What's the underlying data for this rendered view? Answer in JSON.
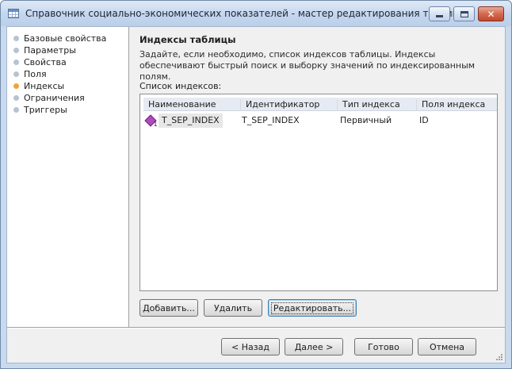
{
  "window": {
    "title": "Справочник социально-экономических показателей - мастер редактирования таблицы",
    "controls": {
      "minimize": "minimize",
      "maximize": "maximize",
      "close": "✕"
    }
  },
  "steps": [
    {
      "label": "Базовые свойства",
      "active": false
    },
    {
      "label": "Параметры",
      "active": false
    },
    {
      "label": "Свойства",
      "active": false
    },
    {
      "label": "Поля",
      "active": false
    },
    {
      "label": "Индексы",
      "active": true
    },
    {
      "label": "Ограничения",
      "active": false
    },
    {
      "label": "Триггеры",
      "active": false
    }
  ],
  "page": {
    "heading": "Индексы таблицы",
    "description": "Задайте, если необходимо, список индексов таблицы. Индексы обеспечивают быстрый поиск и выборку значений по индексированным полям.",
    "list_label": "Список индексов:"
  },
  "table": {
    "columns": [
      "Наименование",
      "Идентификатор",
      "Тип индекса",
      "Поля индекса"
    ],
    "rows": [
      {
        "name": "T_SEP_INDEX",
        "id": "T_SEP_INDEX",
        "type": "Первичный",
        "fields": "ID",
        "icon_number": "1"
      }
    ]
  },
  "list_buttons": {
    "add": "Добавить...",
    "delete": "Удалить",
    "edit": "Редактировать..."
  },
  "nav_buttons": {
    "back": "< Назад",
    "next": "Далее >",
    "finish": "Готово",
    "cancel": "Отмена"
  },
  "colors": {
    "active_step": "#f2a23b",
    "inactive_step": "#b7c3d4",
    "index_icon": "#b04ac0"
  }
}
